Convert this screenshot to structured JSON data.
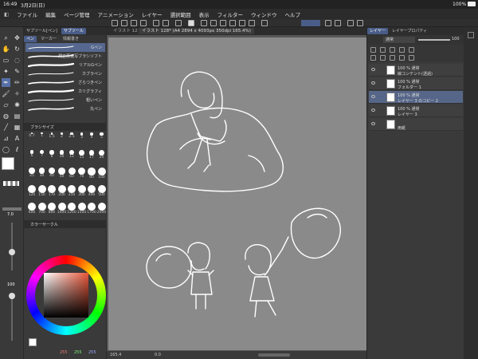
{
  "status": {
    "time": "16:49",
    "date": "3月2日(日)",
    "battery": "100%"
  },
  "menu": [
    "ファイル",
    "編集",
    "ページ管理",
    "アニメーション",
    "レイヤー",
    "選択範囲",
    "表示",
    "フィルター",
    "ウィンドウ",
    "ヘルプ"
  ],
  "subtool": {
    "tabs": [
      "サブツール[ペン]",
      "サブツール"
    ],
    "subtabs": [
      "ペン",
      "マーカー",
      "情報書き"
    ],
    "brushes": [
      "Gペン",
      "潤正原速写ブラシソフト",
      "リアルGペン",
      "カブラペン",
      "ざらつきペン",
      "カリグラフィ",
      "粗いペン",
      "丸ペン"
    ]
  },
  "brush_size": {
    "title": "ブラシサイズ",
    "sizes": [
      "0.7",
      "1",
      "1.5",
      "2",
      "2.5",
      "3",
      "4",
      "5",
      "6",
      "7",
      "8",
      "10",
      "12",
      "15",
      "17",
      "20",
      "25",
      "30",
      "40",
      "50",
      "60",
      "70",
      "80",
      "100",
      "120",
      "150",
      "170",
      "200",
      "250",
      "300",
      "400",
      "500",
      "600",
      "700",
      "800",
      "1000",
      "1200",
      "1500",
      "1700",
      "2000"
    ]
  },
  "tool_sliders": {
    "size_value": "7.0",
    "opacity_value": "100"
  },
  "color": {
    "panel_title": "カラーサークル",
    "r": "255",
    "g": "255",
    "b": "255",
    "main_color": "#ffffff"
  },
  "document": {
    "tab_label": "イラスト 128* (A4 2894 x 4093px 350dpi 165.4%)",
    "tab_prefix": "イラスト 12",
    "zoom": "165.4",
    "angle": "0.0"
  },
  "layers": {
    "tab": "レイヤー",
    "tab2": "レイヤープロパティ",
    "blend_mode": "通常",
    "opacity": "100",
    "items": [
      {
        "line1": "100 %  通常",
        "line2": "線コンテント(透過)"
      },
      {
        "line1": "100 %  通常",
        "line2": "フォルダー 1"
      },
      {
        "line1": "100 %  通常",
        "line2": "レイヤー 3 のコピー 2"
      },
      {
        "line1": "100 %  通常",
        "line2": "レイヤー 3"
      },
      {
        "line1": "",
        "line2": "用紙"
      }
    ]
  }
}
